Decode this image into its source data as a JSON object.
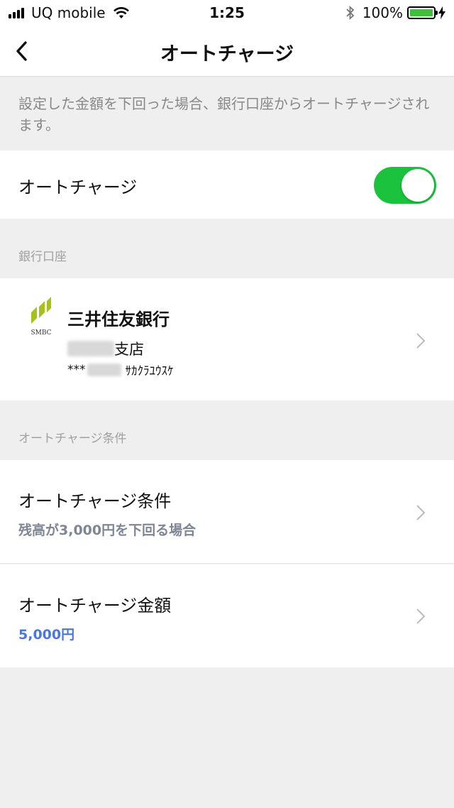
{
  "status_bar": {
    "carrier": "UQ mobile",
    "time": "1:25",
    "battery_text": "100%"
  },
  "nav": {
    "title": "オートチャージ"
  },
  "description": "設定した金額を下回った場合、銀行口座からオートチャージされます。",
  "auto_charge_toggle": {
    "label": "オートチャージ",
    "enabled": true,
    "color": "#1bc23e"
  },
  "bank_section": {
    "header": "銀行口座",
    "bank_name": "三井住友銀行",
    "logo_text": "SMBC",
    "branch_suffix": "支店",
    "account_prefix": "***",
    "account_holder": "ｻｶｸﾗﾕｳｽｹ"
  },
  "conditions_section": {
    "header": "オートチャージ条件",
    "condition": {
      "title": "オートチャージ条件",
      "value": "残高が3,000円を下回る場合",
      "value_color": "#7e8594"
    },
    "amount": {
      "title": "オートチャージ金額",
      "value": "5,000円",
      "value_color": "#4a77dd"
    }
  }
}
